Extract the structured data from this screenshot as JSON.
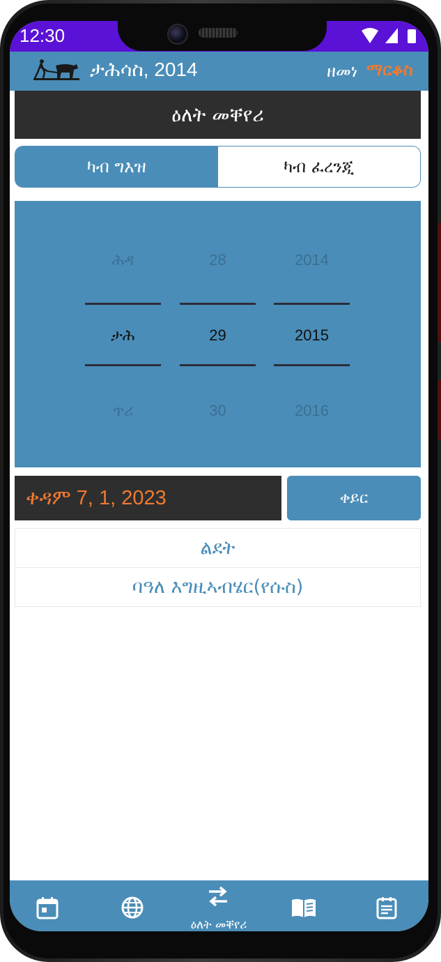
{
  "status": {
    "time": "12:30"
  },
  "appbar": {
    "current_date": "ታሕሳስ, 2014",
    "app_name_1": "ዘመነ",
    "app_name_2": "ማርቆስ"
  },
  "page_title": "ዕለት መቐየሪ",
  "tabs": [
    {
      "label": "ካብ ግእዝ",
      "active": true
    },
    {
      "label": "ካብ ፈረንጂ",
      "active": false
    }
  ],
  "picker": {
    "month": {
      "prev": "ሕዳ",
      "selected": "ታሕ",
      "next": "ጥሪ"
    },
    "day": {
      "prev": "28",
      "selected": "29",
      "next": "30"
    },
    "year": {
      "prev": "2014",
      "selected": "2015",
      "next": "2016"
    }
  },
  "conversion": {
    "result": "ቀዳም 7, 1, 2023",
    "button_label": "ቀይር"
  },
  "holidays": [
    "ልደት",
    "ባዓለ እግዚኣብሄር(የሱስ)"
  ],
  "bottom_nav": [
    {
      "icon": "calendar-icon",
      "label": ""
    },
    {
      "icon": "globe-icon",
      "label": ""
    },
    {
      "icon": "swap-icon",
      "label": "ዕለት መቐየሪ",
      "active": true
    },
    {
      "icon": "book-icon",
      "label": ""
    },
    {
      "icon": "notes-icon",
      "label": ""
    }
  ],
  "colors": {
    "primary": "#4a8db8",
    "dark": "#2e2e2e",
    "accent": "#f07a30",
    "statusbar": "#5a12d6"
  }
}
